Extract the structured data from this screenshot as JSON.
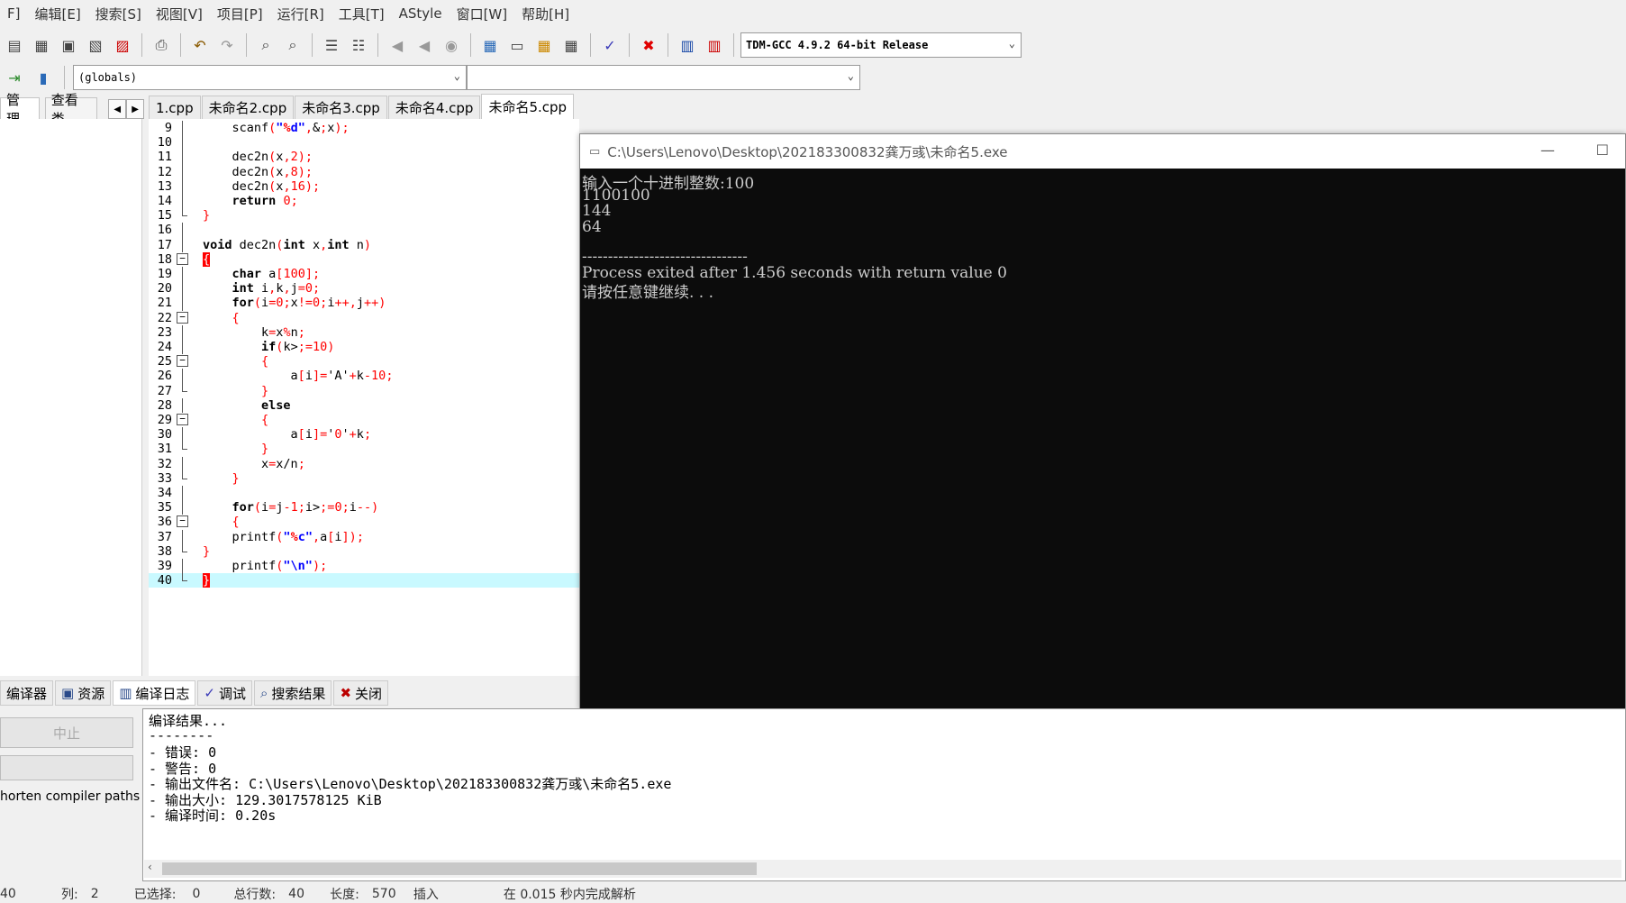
{
  "menu": [
    "F]",
    "编辑[E]",
    "搜索[S]",
    "视图[V]",
    "项目[P]",
    "运行[R]",
    "工具[T]",
    "AStyle",
    "窗口[W]",
    "帮助[H]"
  ],
  "toolbar": {
    "compiler": "TDM-GCC 4.9.2 64-bit Release",
    "scope": "(globals)",
    "member": ""
  },
  "left_tabs": [
    "管理",
    "查看类"
  ],
  "editor_tabs": [
    "1.cpp",
    "未命名2.cpp",
    "未命名3.cpp",
    "未命名4.cpp",
    "未命名5.cpp"
  ],
  "code_lines": [
    {
      "n": "9",
      "t": "    scanf(\"%d\",&x);"
    },
    {
      "n": "10",
      "t": ""
    },
    {
      "n": "11",
      "t": "    dec2n(x,2);"
    },
    {
      "n": "12",
      "t": "    dec2n(x,8);"
    },
    {
      "n": "13",
      "t": "    dec2n(x,16);"
    },
    {
      "n": "14",
      "t": "    return 0;"
    },
    {
      "n": "15",
      "t": "}"
    },
    {
      "n": "16",
      "t": ""
    },
    {
      "n": "17",
      "t": "void dec2n(int x,int n)"
    },
    {
      "n": "18",
      "t": "{"
    },
    {
      "n": "19",
      "t": "    char a[100];"
    },
    {
      "n": "20",
      "t": "    int i,k,j=0;"
    },
    {
      "n": "21",
      "t": "    for(i=0;x!=0;i++,j++)"
    },
    {
      "n": "22",
      "t": "    {"
    },
    {
      "n": "23",
      "t": "        k=x%n;"
    },
    {
      "n": "24",
      "t": "        if(k>=10)"
    },
    {
      "n": "25",
      "t": "        {"
    },
    {
      "n": "26",
      "t": "            a[i]='A'+k-10;"
    },
    {
      "n": "27",
      "t": "        }"
    },
    {
      "n": "28",
      "t": "        else"
    },
    {
      "n": "29",
      "t": "        {"
    },
    {
      "n": "30",
      "t": "            a[i]='0'+k;"
    },
    {
      "n": "31",
      "t": "        }"
    },
    {
      "n": "32",
      "t": "        x=x/n;"
    },
    {
      "n": "33",
      "t": "    }"
    },
    {
      "n": "34",
      "t": ""
    },
    {
      "n": "35",
      "t": "    for(i=j-1;i>=0;i--)"
    },
    {
      "n": "36",
      "t": "    {"
    },
    {
      "n": "37",
      "t": "    printf(\"%c\",a[i]);"
    },
    {
      "n": "38",
      "t": "}"
    },
    {
      "n": "39",
      "t": "    printf(\"\\n\");"
    },
    {
      "n": "40",
      "t": "}"
    }
  ],
  "console": {
    "title": "C:\\Users\\Lenovo\\Desktop\\202183300832龚万彧\\未命名5.exe",
    "lines": [
      "输入一个十进制整数:100",
      "1100100",
      "144",
      "64",
      "",
      "--------------------------------",
      "Process exited after 1.456 seconds with return value 0",
      "请按任意键继续. . ."
    ]
  },
  "bottom_tabs": [
    {
      "label": "编译器",
      "icon": "compiler-icon"
    },
    {
      "label": "资源",
      "icon": "resources-icon"
    },
    {
      "label": "编译日志",
      "icon": "chart-icon"
    },
    {
      "label": "调试",
      "icon": "check-icon"
    },
    {
      "label": "搜索结果",
      "icon": "search-icon"
    },
    {
      "label": "关闭",
      "icon": "close-icon"
    }
  ],
  "bottom_left": {
    "abort_label": "中止",
    "shorten_label": "horten compiler paths"
  },
  "log_lines": [
    "编译结果...",
    "--------",
    "- 错误: 0",
    "- 警告: 0",
    "- 输出文件名: C:\\Users\\Lenovo\\Desktop\\202183300832龚万彧\\未命名5.exe",
    "- 输出大小: 129.3017578125 KiB",
    "- 编译时间: 0.20s"
  ],
  "status": {
    "line": "40",
    "col_label": "列:",
    "col": "2",
    "sel_label": "已选择:",
    "sel": "0",
    "total_label": "总行数:",
    "total": "40",
    "len_label": "长度:",
    "len": "570",
    "mode": "插入",
    "parse": "在 0.015 秒内完成解析"
  }
}
